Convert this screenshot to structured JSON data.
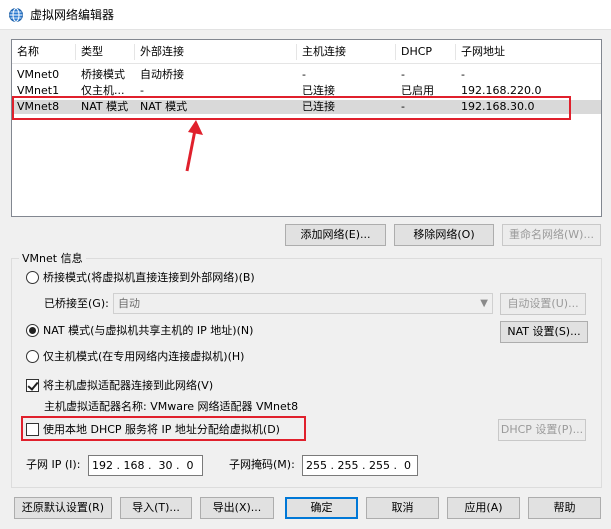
{
  "window": {
    "title": "虚拟网络编辑器",
    "icon": "globe-icon"
  },
  "table": {
    "headers": [
      "名称",
      "类型",
      "外部连接",
      "主机连接",
      "DHCP",
      "子网地址"
    ],
    "rows": [
      [
        "VMnet0",
        "桥接模式",
        "自动桥接",
        "-",
        "-",
        "-"
      ],
      [
        "VMnet1",
        "仅主机...",
        "-",
        "已连接",
        "已启用",
        "192.168.220.0"
      ],
      [
        "VMnet8",
        "NAT 模式",
        "NAT 模式",
        "已连接",
        "-",
        "192.168.30.0"
      ]
    ],
    "selected_row": 2
  },
  "list_buttons": {
    "add": "添加网络(E)...",
    "remove": "移除网络(O)",
    "rename": "重命名网络(W)..."
  },
  "vmnet_info": {
    "label": "VMnet 信息",
    "bridged_label": "桥接模式(将虚拟机直接连接到外部网络)(B)",
    "bridged_to_label": "已桥接至(G):",
    "bridged_to_value": "自动",
    "auto_settings": "自动设置(U)...",
    "nat_label": "NAT 模式(与虚拟机共享主机的 IP 地址)(N)",
    "nat_settings": "NAT 设置(S)...",
    "hostonly_label": "仅主机模式(在专用网络内连接虚拟机)(H)",
    "selected_mode": "nat",
    "connect_adapter_label": "将主机虚拟适配器连接到此网络(V)",
    "connect_adapter_checked": true,
    "adapter_name_label": "主机虚拟适配器名称: VMware 网络适配器 VMnet8",
    "dhcp_label": "使用本地 DHCP 服务将 IP 地址分配给虚拟机(D)",
    "dhcp_checked": false,
    "dhcp_settings": "DHCP 设置(P)...",
    "subnet_ip_label": "子网 IP (I):",
    "subnet_ip_value": "192 . 168 .  30 .  0",
    "subnet_mask_label": "子网掩码(M):",
    "subnet_mask_value": "255 . 255 . 255 .  0"
  },
  "footer_buttons": {
    "restore": "还原默认设置(R)",
    "import": "导入(T)...",
    "export": "导出(X)...",
    "ok": "确定",
    "cancel": "取消",
    "apply": "应用(A)",
    "help": "帮助"
  },
  "colors": {
    "annotation": "#e0202c",
    "selection": "#d9d9d9"
  }
}
